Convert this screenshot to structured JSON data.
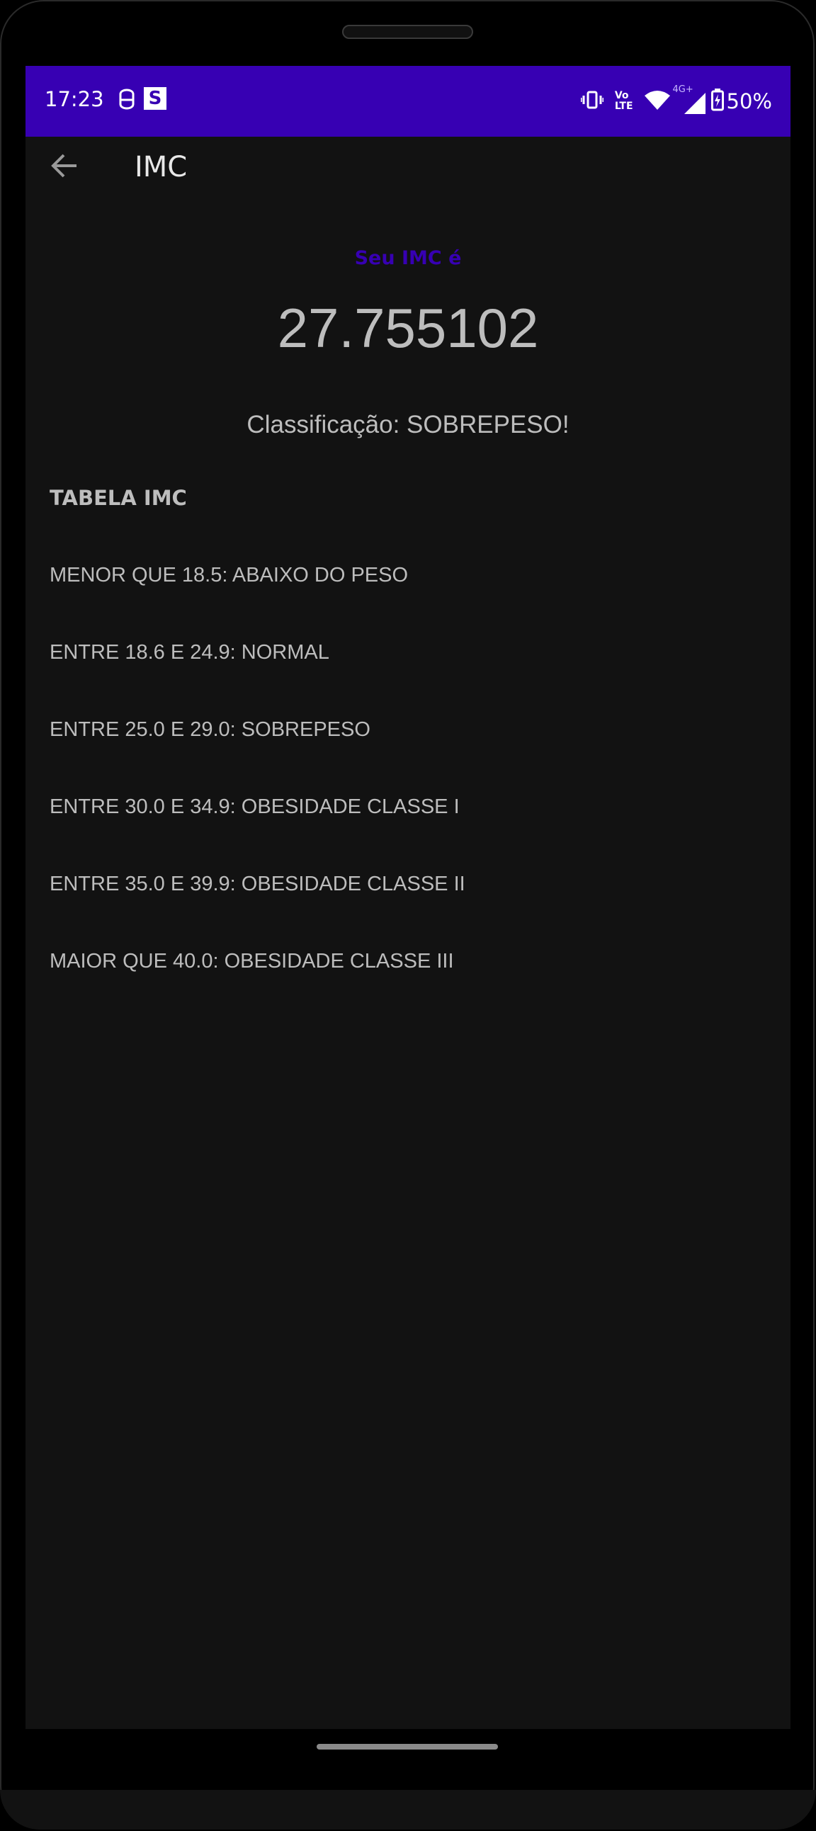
{
  "status_bar": {
    "time": "17:23",
    "battery_percent": "50%",
    "left_icons": [
      "fingerprint-icon",
      "app-s-icon"
    ],
    "app_s_letter": "S",
    "right_icons": [
      "vibrate-icon",
      "volte-icon",
      "wifi-icon",
      "signal-4g-icon",
      "battery-icon"
    ],
    "volte_top": "Vo",
    "volte_bottom": "LTE",
    "network_type": "4G+",
    "background": "#3700b3"
  },
  "app_bar": {
    "title": "IMC",
    "back_icon": "arrow-left-icon"
  },
  "result": {
    "label": "Seu IMC é",
    "value": "27.755102",
    "classification": "Classificação: SOBREPESO!",
    "label_color": "#3700b3"
  },
  "table": {
    "title": "TABELA IMC",
    "rows": [
      "MENOR QUE 18.5: ABAIXO DO PESO",
      "ENTRE 18.6 E 24.9: NORMAL",
      "ENTRE 25.0 E 29.0: SOBREPESO",
      "ENTRE 30.0 E 34.9: OBESIDADE CLASSE I",
      "ENTRE 35.0 E 39.9: OBESIDADE CLASSE II",
      "MAIOR QUE 40.0: OBESIDADE CLASSE III"
    ]
  }
}
